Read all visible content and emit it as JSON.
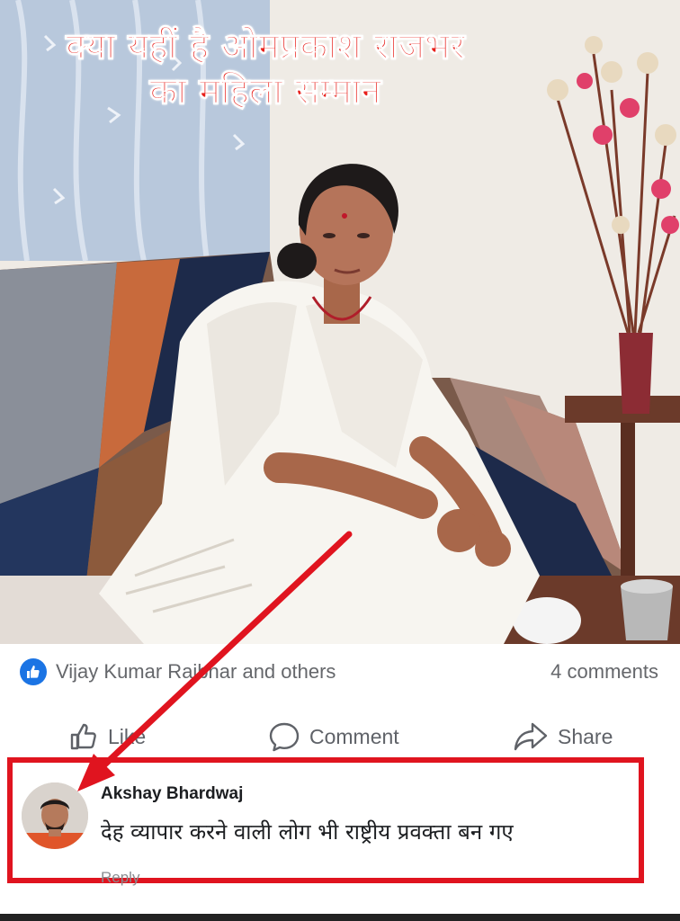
{
  "post": {
    "headline_line1": "क्या यहीं है ओमप्रकाश राजभर",
    "headline_line2": "का महिला सम्मान"
  },
  "reactions": {
    "reactors": "Vijay Kumar Rajbhar and others",
    "comment_count": "4 comments"
  },
  "actions": {
    "like_label": "Like",
    "comment_label": "Comment",
    "share_label": "Share"
  },
  "comment": {
    "author": "Akshay Bhardwaj",
    "text": "देह व्यापार करने वाली लोग भी राष्ट्रीय प्रवक्ता बन गए",
    "reply_label": "Reply"
  },
  "colors": {
    "headline": "#e8201b",
    "highlight": "#e0141f",
    "like_blue": "#1b74e4",
    "muted_text": "#65676b"
  },
  "icons": [
    "like-thumb-icon",
    "comment-bubble-icon",
    "share-arrow-icon",
    "like-reaction-badge-icon",
    "pointer-arrow-icon"
  ]
}
